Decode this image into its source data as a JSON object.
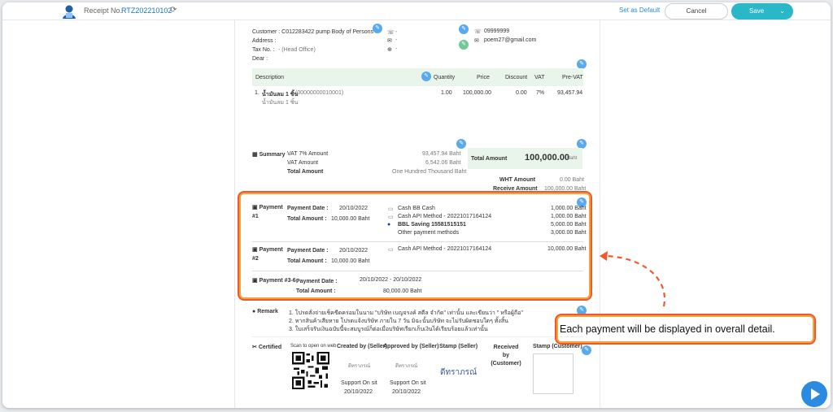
{
  "topbar": {
    "receipt_label": "Receipt No.",
    "receipt_no": "RTZ202210102",
    "set_default": "Set as Default",
    "cancel": "Cancel",
    "save": "Save"
  },
  "customer": {
    "customer_line": "Customer : C012283422 pump Body of Persons",
    "address_label": "Address :",
    "tax_label": "Tax No. :",
    "tax_value": "- (Head Office)",
    "dear_label": "Dear :",
    "phone_dash": "-",
    "email_dash": "-",
    "web_dash": "-",
    "seller_phone": "09999999",
    "seller_email": "poem27@gmail.com"
  },
  "items": {
    "headers": {
      "description": "Description",
      "quantity": "Quantity",
      "price": "Price",
      "discount": "Discount",
      "vat": "VAT",
      "pre_vat": "Pre-VAT"
    },
    "row": {
      "index": "1.",
      "name": "น้ำมันลม 1 ชิ้น",
      "code": "(00000000010001)",
      "sub": "น้ำมันลม 1 ชิ้น",
      "quantity": "1.00",
      "price": "100,000.00",
      "discount": "0.00",
      "vat": "7%",
      "pre_vat": "93,457.94"
    }
  },
  "summary": {
    "label": "Summary",
    "vat7_label": "VAT 7% Amount",
    "vat7_value": "93,457.94 Baht",
    "vat_label": "VAT Amount",
    "vat_value": "6,542.06 Baht",
    "total_label": "Total Amount",
    "total_text": "One Hundred Thousand Baht",
    "box_label": "Total Amount",
    "box_value": "100,000.00",
    "box_unit": "Baht",
    "wht_label": "WHT Amount",
    "wht_value": "0.00 Baht",
    "receive_label": "Receive Amount",
    "receive_value": "100,000.00 Baht"
  },
  "payments": [
    {
      "title_a": "Payment",
      "title_b": "#1",
      "date_label": "Payment Date :",
      "date": "20/10/2022",
      "amount_label": "Total Amount :",
      "amount": "10,000.00 Baht",
      "methods": [
        {
          "name": "Cash BB Cash",
          "value": "1,000.00 Baht"
        },
        {
          "name": "Cash API Method - 20221017164124",
          "value": "1,000.00 Baht"
        },
        {
          "name": "BBL Saving 15581515151",
          "value": "5,000.00 Baht"
        },
        {
          "name": "Other payment methods",
          "value": "3,000.00 Baht"
        }
      ]
    },
    {
      "title_a": "Payment",
      "title_b": "#2",
      "date_label": "Payment Date :",
      "date": "20/10/2022",
      "amount_label": "Total Amount :",
      "amount": "10,000.00 Baht",
      "methods": [
        {
          "name": "Cash API Method - 20221017164124",
          "value": "10,000.00 Baht"
        }
      ]
    },
    {
      "title_a": "Payment #3-6",
      "date_label": "Payment Date :",
      "date": "20/10/2022 - 20/10/2022",
      "amount_label": "Total Amount :",
      "amount": "80,000.00 Baht"
    }
  ],
  "remark": {
    "label": "Remark",
    "lines": [
      "1. โปรดสั่งจ่ายเช็คขีดคร่อมในนาม \"บริษัท เบญจรงค์ สตีล จำกัด\" เท่านั้น และเขียนว่า \" หรือผู้ถือ\"",
      "2. หากสินค้าเสียหาย โปรดแจ้งบริษัท ภายใน 7 วัน มิฉะนั้นบริษัท จะไม่รับผิดชอบใดๆ ทั้งสิ้น",
      "3. ใบเสร็จรับเงินฉบับนี้จะสมบูรณ์ก็ต่อเมื่อบริษัทเรียกเก็บเงินได้เรียบร้อยแล้วเท่านั้น"
    ]
  },
  "certified": {
    "label": "Certified",
    "scan": "Scan to open on web",
    "created_by": "Created by (Seller)",
    "approved_by": "Approved by (Seller)",
    "stamp_seller": "Stamp (Seller)",
    "received_by": "Received by (Customer)",
    "stamp_customer": "Stamp (Customer)",
    "created_sig": "ดีทราภรณ์",
    "approved_sig": "ดีทราภรณ์",
    "stamp_sig": "ดีทราภรณ์",
    "created_name": "Support On sit",
    "approved_name": "Support On sit",
    "created_date": "20/10/2022",
    "approved_date": "20/10/2022"
  },
  "callout": {
    "text": "Each payment will be displayed in overall detail."
  },
  "colors": {
    "accent": "#2ab7c7",
    "link": "#1a73c9",
    "highlight_outer": "#ee5a2f",
    "highlight_inner": "#f3a33a",
    "header_bg": "#e9f5ea"
  }
}
